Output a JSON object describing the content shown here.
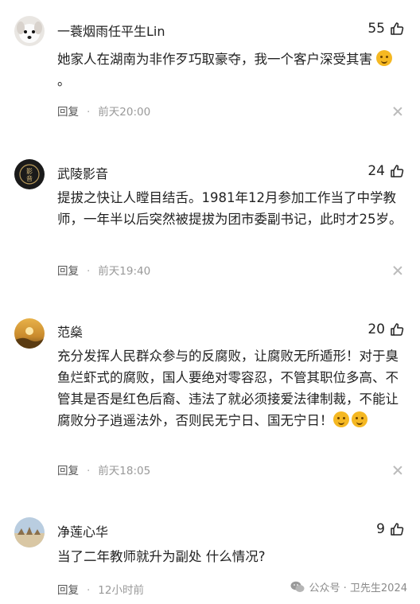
{
  "comments": [
    {
      "username": "一蓑烟雨任平生Lin",
      "likes": "55",
      "text": "她家人在湖南为非作歹巧取豪夺，我一个客户深受其害",
      "text_suffix": "。",
      "emoji": "teary-laugh-emoji",
      "reply_label": "回复",
      "time": "前天20:00"
    },
    {
      "username": "武陵影音",
      "likes": "24",
      "text": "提拔之快让人瞠目结舌。1981年12月参加工作当了中学教师，一年半以后突然被提拔为团市委副书记，此时才25岁。",
      "reply_label": "回复",
      "time": "前天19:40"
    },
    {
      "username": "范燊",
      "likes": "20",
      "text": "充分发挥人民群众参与的反腐败，让腐败无所遁形！对于臭鱼烂虾式的腐败，国人要绝对零容忍，不管其职位多高、不管其是否是红色后裔、违法了就必须接爱法律制裁，不能让腐败分子逍遥法外，否则民无宁日、国无宁日！",
      "emoji": "thinking-emoji",
      "reply_label": "回复",
      "time": "前天18:05"
    },
    {
      "username": "净莲心华",
      "likes": "9",
      "text": "当了二年教师就升为副处 什么情况?",
      "reply_label": "回复",
      "time": "12小时前"
    }
  ],
  "watermark": {
    "label": "公众号 · 卫先生2024",
    "icon": "wechat-icon"
  }
}
